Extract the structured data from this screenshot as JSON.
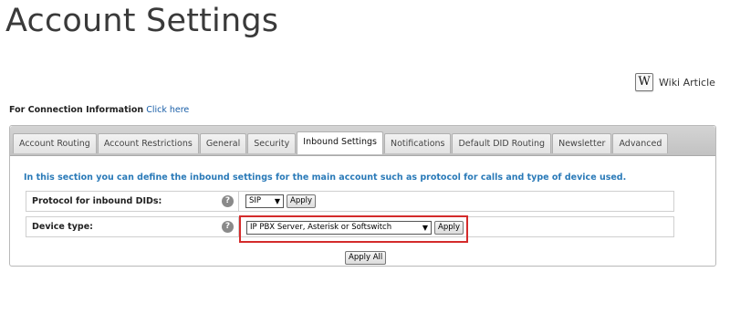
{
  "page": {
    "title": "Account Settings"
  },
  "wiki": {
    "icon": "W",
    "label": "Wiki Article"
  },
  "connection": {
    "label": "For Connection Information",
    "link": "Click here"
  },
  "tabs": [
    {
      "label": "Account Routing",
      "active": false
    },
    {
      "label": "Account Restrictions",
      "active": false
    },
    {
      "label": "General",
      "active": false
    },
    {
      "label": "Security",
      "active": false
    },
    {
      "label": "Inbound Settings",
      "active": true
    },
    {
      "label": "Notifications",
      "active": false
    },
    {
      "label": "Default DID Routing",
      "active": false
    },
    {
      "label": "Newsletter",
      "active": false
    },
    {
      "label": "Advanced",
      "active": false
    }
  ],
  "content": {
    "info": "In this section you can define the inbound settings for the main account such as protocol for calls and type of device used.",
    "rows": [
      {
        "label": "Protocol for inbound DIDs:",
        "help": "?",
        "value": "SIP",
        "apply": "Apply"
      },
      {
        "label": "Device type:",
        "help": "?",
        "value": "IP PBX Server, Asterisk or Softswitch",
        "apply": "Apply"
      }
    ],
    "apply_all": "Apply All"
  },
  "colors": {
    "info_text": "#2a7ab8",
    "highlight": "#d42b2b",
    "link": "#1a5fa8"
  },
  "icons": {
    "help": "help-circle-icon",
    "dropdown": "chevron-down-icon",
    "wiki": "wikipedia-icon"
  }
}
